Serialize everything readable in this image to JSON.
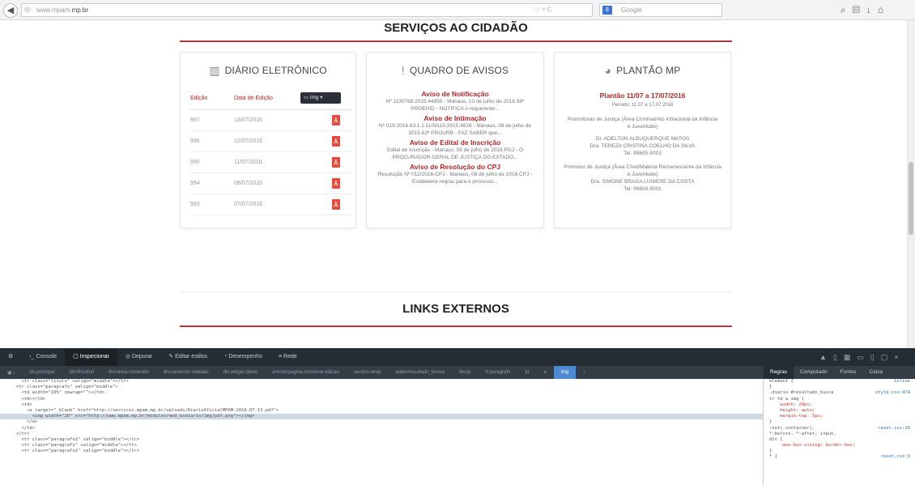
{
  "browser": {
    "url_prefix": "www.",
    "url_domain_grey": "mpam.",
    "url_domain_bold": "mp.br",
    "search_placeholder": "Google",
    "search_engine": "8"
  },
  "sections": {
    "servicos": "SERVIÇOS AO CIDADÃO",
    "links": "LINKS EXTERNOS"
  },
  "diario": {
    "title": "DIÁRIO ELETRÔNICO",
    "col_edicao": "Edição",
    "col_data": "Data de Edição",
    "tooltip": "img",
    "rows": [
      {
        "edicao": "997",
        "data": "13/07/2016"
      },
      {
        "edicao": "996",
        "data": "12/07/2016"
      },
      {
        "edicao": "995",
        "data": "11/07/2016"
      },
      {
        "edicao": "994",
        "data": "08/07/2016"
      },
      {
        "edicao": "993",
        "data": "07/07/2016"
      }
    ]
  },
  "avisos": {
    "title": "QUADRO DE AVISOS",
    "items": [
      {
        "title": "Aviso de Notificação",
        "text": "Nº 1130788.2015.44855 - Manaus, 13 de julho de 2016.56ª PROEHID - NOTIFICA o requerente..."
      },
      {
        "title": "Aviso de Intimação",
        "text": "Nº 019.2016.63.1.1.1109110.2015.4826 - Manaus, 08 de julho de 2015.63ª PROURB - FAZ SABER que..."
      },
      {
        "title": "Aviso de Edital de Inscrição",
        "text": "Edital de Inscrição - Manaus, 08 de julho de 2016.PGJ - O PROCURADOR-GERAL DE JUSTIÇA DO ESTADO..."
      },
      {
        "title": "Aviso de Resolução do CPJ",
        "text": "Resolução Nº 012/2016-CPJ - Manaus, 08 de julho de 2016.CPJ - Estabelece regras para o processo..."
      }
    ]
  },
  "plantao": {
    "title": "PLANTÃO MP",
    "heading": "Plantão 11/07 a 17/07/2016",
    "periodo": "Período: 11.07 a 17.07.2016",
    "blocks": [
      {
        "area": "Promotoras de Justiça (Área Criminal/Ato Infracional da Infância e Juventude)",
        "names": "Dr. ADELTON ALBUQUERQUE MATOS",
        "names2": "Dra. TEREZA CRISTINA COELHO DA SILVA",
        "tel": "Tel: 99600-5003"
      },
      {
        "area": "Promotor de Justiça (Área Cível/Matéria Remanescente da Infância e Juventude)",
        "names": "Dra. SIMONE BRAGA LUNIERE DA COSTA",
        "tel": "Tel: 99600-5001"
      }
    ]
  },
  "devtools": {
    "tabs": [
      "Console",
      "Inspecionar",
      "Depurar",
      "Editar estilos",
      "Desempenho",
      "Rede"
    ],
    "crumbs": [
      "div.principal",
      "div#frisuhel",
      "div#area-conteudo",
      "div.container.cidadao",
      "div.widget.diario",
      "article#pagina.container.edicao",
      "section.wrap",
      "table#resultado_busca",
      "tbody",
      "tr.paragrafo",
      "td",
      "a",
      "img"
    ],
    "side_tabs": [
      "Regras",
      "Computado",
      "Fontes",
      "Caixa"
    ],
    "markup": [
      "        <tr class=\"titulo\" valign=\"middle\"></tr>",
      "      <tr class=\"paragrafo\" valign=\"middle\">",
      "        <td width=\"10%\" nowrap=\"\"></td>",
      "        <td></td>",
      "        <td>",
      "          <a target=\"_blank\" href=\"http://servicos.mpam.mp.br/uploads/DiarioOficialMPAM-2016-07-13.pdf\">",
      "            <img width=\"20\" src=\"http://www.mpam.mp.br/modulos/mod_bsdiario/img/pdf.png\"></img>",
      "          </a>",
      "        </td>",
      "      </tr>",
      "        <tr class=\"paragrafo2\" valign=\"middle\"></tr>",
      "        <tr class=\"paragrafo\" valign=\"middle\"></tr>",
      "        <tr class=\"paragrafo2\" valign=\"middle\"></tr>"
    ],
    "rules": [
      {
        "text": "element {",
        "src": "inline"
      },
      {
        "text": "}",
        "src": ""
      },
      {
        "text": ".diario #resultado_busca",
        "src": "style.css:474"
      },
      {
        "text": "tr td a img {",
        "src": ""
      },
      {
        "text": "    width: 20px;",
        "src": ""
      },
      {
        "text": "    height: auto;",
        "src": ""
      },
      {
        "text": "    margin-top: 5px;",
        "src": ""
      },
      {
        "text": "}",
        "src": ""
      },
      {
        "text": ":not(.container),",
        "src": "reset.css:10"
      },
      {
        "text": "*:before, *:after, input,",
        "src": ""
      },
      {
        "text": "div {",
        "src": ""
      },
      {
        "text": "    -moz-box-sizing: border-box;",
        "src": ""
      },
      {
        "text": "}",
        "src": ""
      },
      {
        "text": "* {",
        "src": "reset.css:9"
      }
    ]
  }
}
